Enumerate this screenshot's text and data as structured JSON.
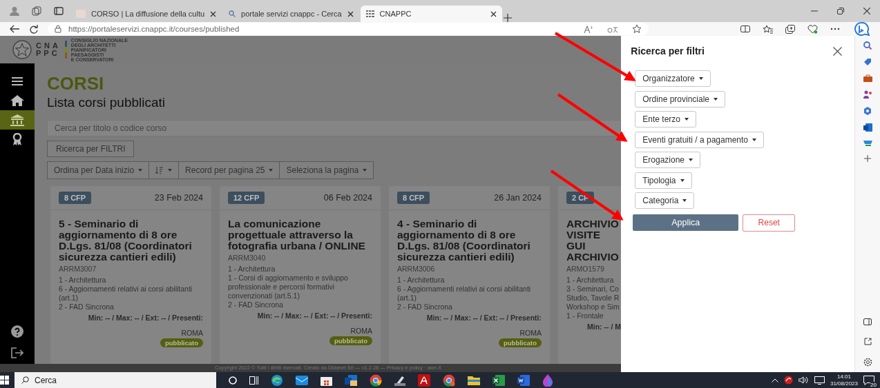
{
  "browser": {
    "tabs": [
      {
        "title": "CORSO | La diffusione della cultu",
        "selected": false
      },
      {
        "title": "portale servizi cnappc - Cerca",
        "selected": false
      },
      {
        "title": "CNAPPC",
        "selected": true
      }
    ],
    "url": "https://portaleservizi.cnappc.it/courses/published"
  },
  "header": {
    "logo_letters": [
      "CNA",
      "PPC"
    ],
    "logo_text": "CONSIGLIO NAZIONALE\nDEGLI ARCHITETTI\nPIANIFICATORI\nPAESAGGISTI\nE CONSERVATORI"
  },
  "nav": {
    "items": [
      {
        "kind": "menu",
        "selected": false
      },
      {
        "kind": "home",
        "selected": false
      },
      {
        "kind": "courses",
        "selected": true
      },
      {
        "kind": "award",
        "selected": false
      }
    ]
  },
  "page": {
    "title": "CORSI",
    "subtitle": "Lista corsi pubblicati",
    "search": {
      "placeholder": "Cerca per titolo o codice corso"
    },
    "filter_button": "Ricerca per FILTRI",
    "toolbar": [
      {
        "kind": "text",
        "label": "Ordina per Data inizio"
      },
      {
        "kind": "sort"
      },
      {
        "kind": "text",
        "label": "Record per pagina 25"
      },
      {
        "kind": "text",
        "label": "Seleziona la pagina"
      }
    ]
  },
  "cards": [
    {
      "kind": "full",
      "cfp": "8 CFP",
      "date": "23 Feb 2024",
      "title": "5 - Seminario di aggiornamento di 8 ore D.Lgs. 81/08 (Coordinatori sicurezza cantieri edili)",
      "code": "ARRM3007",
      "categories": [
        "1 - Architettura",
        "6 - Aggiornamenti relativi ai corsi abilitanti (art.1)",
        "2 - FAD Sincrona"
      ],
      "stats": "Min: -- / Max: -- / Ext: -- / Presenti:",
      "city": "ROMA",
      "status": "pubblicato"
    },
    {
      "kind": "full",
      "cfp": "12 CFP",
      "date": "06 Feb 2024",
      "title": "La comunicazione progettuale attraverso la fotografia urbana / ONLINE",
      "code": "ARRM3040",
      "categories": [
        "1 - Architettura",
        "1 - Corsi di aggiornamento e sviluppo professionale e percorsi formativi convenzionati (art.5.1)",
        "2 - FAD Sincrona"
      ],
      "stats": "Min: -- / Max: -- / Ext: -- / Presenti:",
      "city": "ROMA",
      "status": "pubblicato"
    },
    {
      "kind": "full",
      "cfp": "8 CFP",
      "date": "26 Jan 2024",
      "title": "4 - Seminario di aggiornamento di 8 ore D.Lgs. 81/08 (Coordinatori sicurezza cantieri edili)",
      "code": "ARRM3006",
      "categories": [
        "1 - Architettura",
        "6 - Aggiornamenti relativi ai corsi abilitanti (art.1)",
        "2 - FAD Sincrona"
      ],
      "stats": "Min: -- / Max: -- / Ext: -- / Presenti:",
      "city": "ROMA",
      "status": "pubblicato"
    },
    {
      "kind": "cut",
      "cfp": "2 CF",
      "title": "ARCHIVIO\nVISITE GUI\nARCHIVIO",
      "code": "ARMO1579",
      "categories": [
        "1 - Architettura",
        "3 - Seminari, Co\nStudio, Tavole R\nWorkshop e Sim",
        "1 - Frontale"
      ],
      "stats": "Min: -- / M"
    }
  ],
  "footer": "Copyright 2022 © Tutti i diritti riservati. Creato da Didanet Srl — v1.2.28 — Privacy e policy · awn.it",
  "filter_panel": {
    "title": "Ricerca per filtri",
    "filters": [
      "Organizzatore",
      "Ordine provinciale",
      "Ente terzo",
      "Eventi gratuiti / a pagamento",
      "Erogazione",
      "Tipologia",
      "Categoria"
    ],
    "apply": "Applica",
    "reset": "Reset"
  },
  "taskbar": {
    "search": "Cerca",
    "time": "14:01",
    "date": "31/08/2023",
    "notifications": "20"
  }
}
